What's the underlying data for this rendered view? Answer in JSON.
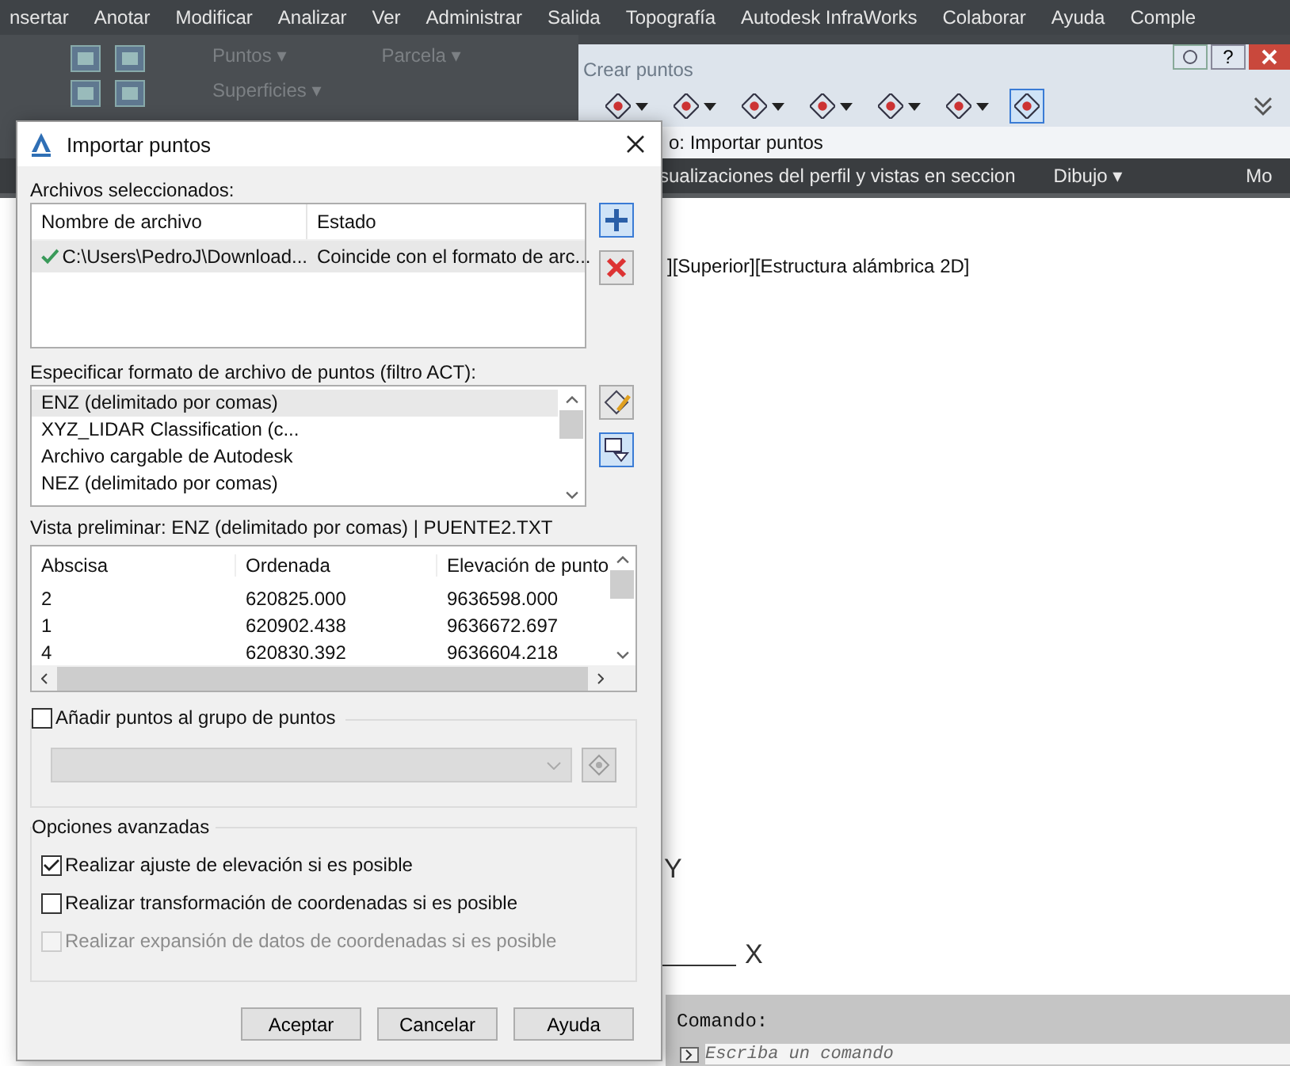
{
  "menu_bar": [
    "nsertar",
    "Anotar",
    "Modificar",
    "Analizar",
    "Ver",
    "Administrar",
    "Salida",
    "Topografía",
    "Autodesk InfraWorks",
    "Colaborar",
    "Ayuda",
    "Comple"
  ],
  "ribbon": {
    "panels": [
      {
        "label": "Puntos ▾"
      },
      {
        "label": "Superficies ▾"
      },
      {
        "label": "Parcela ▾"
      }
    ]
  },
  "toolbar": {
    "title": "Crear puntos",
    "help_label": "?",
    "tools": [
      {
        "selected": false
      },
      {
        "selected": false
      },
      {
        "selected": false
      },
      {
        "selected": false
      },
      {
        "selected": false
      },
      {
        "selected": false
      },
      {
        "selected": true
      }
    ],
    "command_label": "o: Importar puntos"
  },
  "tab_bar": [
    "sualizaciones del perfil y vistas en seccion",
    "Dibujo ▾",
    "Mo"
  ],
  "viewport_label": "][Superior][Estructura alámbrica 2D]",
  "ucs": {
    "y_label": "Y",
    "x_label": "X"
  },
  "command_line": {
    "label": "Comando:",
    "placeholder": "Escriba un comando"
  },
  "dialog": {
    "title": "Importar puntos",
    "files_label": "Archivos seleccionados:",
    "files_columns": [
      "Nombre de archivo",
      "Estado"
    ],
    "files": [
      {
        "name": "C:\\Users\\PedroJ\\Download...",
        "status": "Coincide con el formato de arc...",
        "selected": true
      }
    ],
    "format_label": "Especificar formato de archivo de puntos (filtro ACT):",
    "formats": [
      {
        "label": "ENZ (delimitado por comas)",
        "selected": true
      },
      {
        "label": "XYZ_LIDAR Classification (c...",
        "selected": false
      },
      {
        "label": "Archivo cargable de Autodesk",
        "selected": false
      },
      {
        "label": "NEZ (delimitado por comas)",
        "selected": false
      }
    ],
    "preview_label": "Vista preliminar: ENZ (delimitado por comas) | PUENTE2.TXT",
    "preview_columns": [
      "Abscisa",
      "Ordenada",
      "Elevación de punto"
    ],
    "preview_rows": [
      [
        "2",
        "620825.000",
        "9636598.000"
      ],
      [
        "1",
        "620902.438",
        "9636672.697"
      ],
      [
        "4",
        "620830.392",
        "9636604.218"
      ]
    ],
    "group_option": {
      "label": "Añadir puntos al grupo de puntos",
      "checked": false
    },
    "advanced_label": "Opciones avanzadas",
    "advanced_options": [
      {
        "label": "Realizar ajuste de elevación si es posible",
        "checked": true,
        "disabled": false
      },
      {
        "label": "Realizar transformación de coordenadas si es posible",
        "checked": false,
        "disabled": false
      },
      {
        "label": "Realizar expansión de datos de coordenadas si es posible",
        "checked": false,
        "disabled": true
      }
    ],
    "buttons": [
      "Aceptar",
      "Cancelar",
      "Ayuda"
    ]
  }
}
